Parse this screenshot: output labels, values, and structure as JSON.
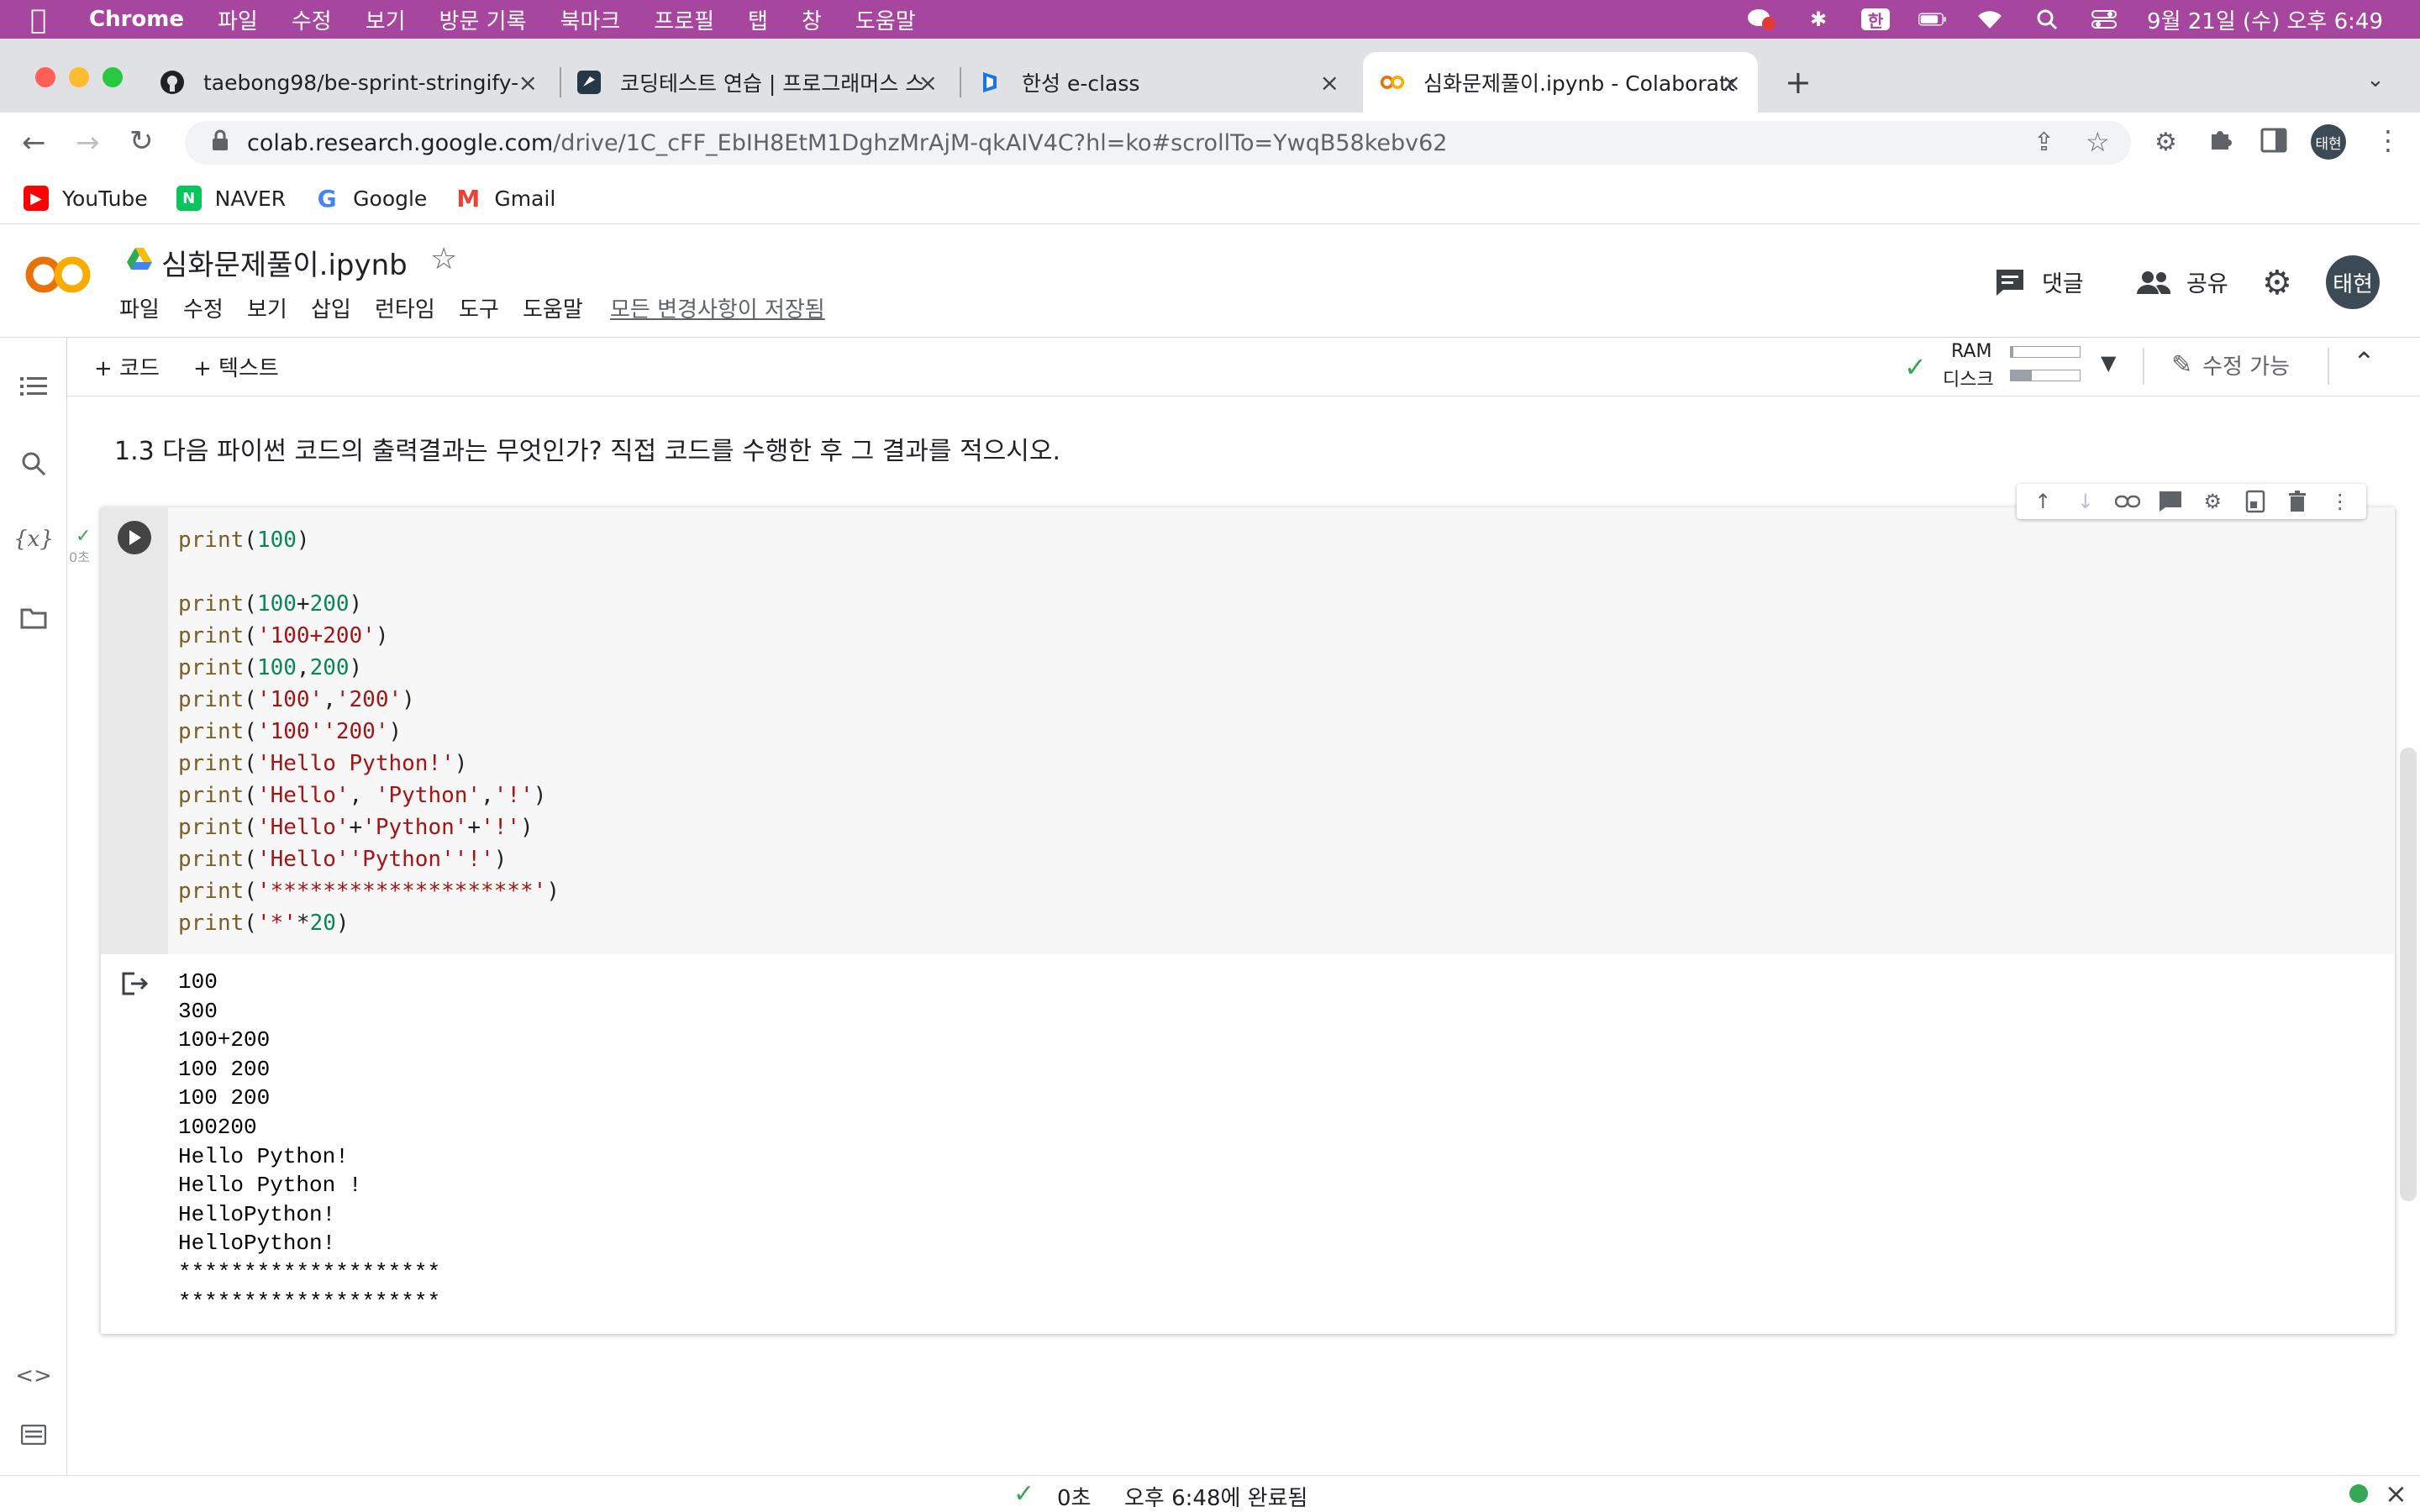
{
  "menubar": {
    "app": "Chrome",
    "items": [
      "파일",
      "수정",
      "보기",
      "방문 기록",
      "북마크",
      "프로필",
      "탭",
      "창",
      "도움말"
    ],
    "ime": "한",
    "clock": "9월 21일 (수) 오후 6:49"
  },
  "tabs": [
    {
      "title": "taebong98/be-sprint-stringify-",
      "icon": "github-icon"
    },
    {
      "title": "코딩테스트 연습 | 프로그래머스 스쿨",
      "icon": "programmers-icon"
    },
    {
      "title": "한성 e-class",
      "icon": "eclass-icon"
    },
    {
      "title": "심화문제풀이.ipynb - Colaborator",
      "icon": "colab-icon",
      "active": true
    }
  ],
  "address": {
    "host": "colab.research.google.com",
    "path": "/drive/1C_cFF_EbIH8EtM1DghzMrAjM-qkAIV4C?hl=ko#scrollTo=YwqB58kebv62"
  },
  "bookmarks": [
    "YouTube",
    "NAVER",
    "Google",
    "Gmail"
  ],
  "colab": {
    "title": "심화문제풀이.ipynb",
    "menu": [
      "파일",
      "수정",
      "보기",
      "삽입",
      "런타임",
      "도구",
      "도움말"
    ],
    "saved_status": "모든 변경사항이 저장됨",
    "comment": "댓글",
    "share": "공유",
    "avatar": "태현",
    "add_code": "+ 코드",
    "add_text": "+ 텍스트",
    "ram": "RAM",
    "disk": "디스크",
    "edit_mode": "수정 가능",
    "exec_time": "0초"
  },
  "section_text": "1.3 다음 파이썬 코드의 출력결과는 무엇인가? 직접 코드를 수행한 후 그 결과를 적으시오.",
  "code_lines": [
    "print(100)",
    "",
    "print(100+200)",
    "print('100+200')",
    "print(100,200)",
    "print('100','200')",
    "print('100''200')",
    "print('Hello Python!')",
    "print('Hello', 'Python','!')",
    "print('Hello'+'Python'+'!')",
    "print('Hello''Python''!')",
    "print('********************')",
    "print('*'*20)"
  ],
  "output_lines": [
    "100",
    "300",
    "100+200",
    "100 200",
    "100 200",
    "100200",
    "Hello Python!",
    "Hello Python !",
    "HelloPython!",
    "HelloPython!",
    "********************",
    "********************"
  ],
  "status": {
    "duration": "0초",
    "completed": "오후 6:48에 완료됨"
  },
  "colors": {
    "menubar": "#a6469e",
    "colab_orange": "#f9ab00",
    "check_green": "#34a853"
  }
}
